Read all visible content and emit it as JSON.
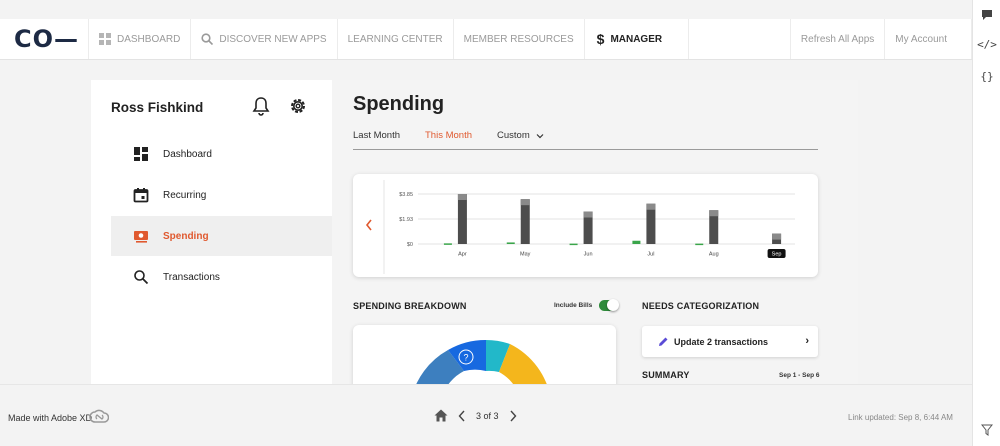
{
  "nav": {
    "logo": "CO—",
    "items": [
      {
        "label": "DASHBOARD",
        "icon": "grid-icon"
      },
      {
        "label": "DISCOVER NEW APPS",
        "icon": "search-icon"
      },
      {
        "label": "LEARNING CENTER"
      },
      {
        "label": "MEMBER RESOURCES"
      },
      {
        "label": "MANAGER",
        "icon": "dollar-icon",
        "active": true
      }
    ],
    "right": [
      "Refresh All Apps",
      "My Account"
    ]
  },
  "sidebar": {
    "user": "Ross Fishkind",
    "items": [
      {
        "label": "Dashboard",
        "icon": "dashboard-icon"
      },
      {
        "label": "Recurring",
        "icon": "calendar-icon"
      },
      {
        "label": "Spending",
        "icon": "money-icon",
        "active": true
      },
      {
        "label": "Transactions",
        "icon": "search-icon"
      }
    ]
  },
  "main": {
    "title": "Spending",
    "tabs": [
      {
        "label": "Last Month"
      },
      {
        "label": "This Month",
        "active": true
      },
      {
        "label": "Custom"
      }
    ],
    "breakdown_title": "SPENDING BREAKDOWN",
    "include_bills": "Include Bills",
    "needs_title": "NEEDS CATEGORIZATION",
    "update_label": "Update 2 transactions",
    "summary_title": "SUMMARY",
    "summary_range": "Sep 1 - Sep 6",
    "donut_help": "?"
  },
  "chart_data": {
    "type": "bar",
    "categories": [
      "Apr",
      "May",
      "Jun",
      "Jul",
      "Aug",
      "Sep"
    ],
    "selected_category": "Sep",
    "yticks": [
      "$0",
      "$1.93",
      "$3.85"
    ],
    "ylim": [
      0,
      3.85
    ],
    "series": [
      {
        "values": [
          3.85,
          3.45,
          2.5,
          3.1,
          2.6,
          0.8
        ],
        "color": "#4d4d4d"
      },
      {
        "values": [
          0.05,
          0.12,
          0.03,
          0.25,
          0.03,
          0
        ],
        "color": "#3aa54a"
      }
    ],
    "grid": true
  },
  "colors": {
    "accent": "#e0592f",
    "toggle": "#2e8b3a",
    "donut": [
      "#3d7fbf",
      "#1769e0",
      "#22b8c9",
      "#f4b61c"
    ]
  },
  "footer": {
    "made_with": "Made with Adobe XD",
    "page": "3 of 3",
    "link_updated": "Link updated: Sep 8, 6:44 AM"
  }
}
